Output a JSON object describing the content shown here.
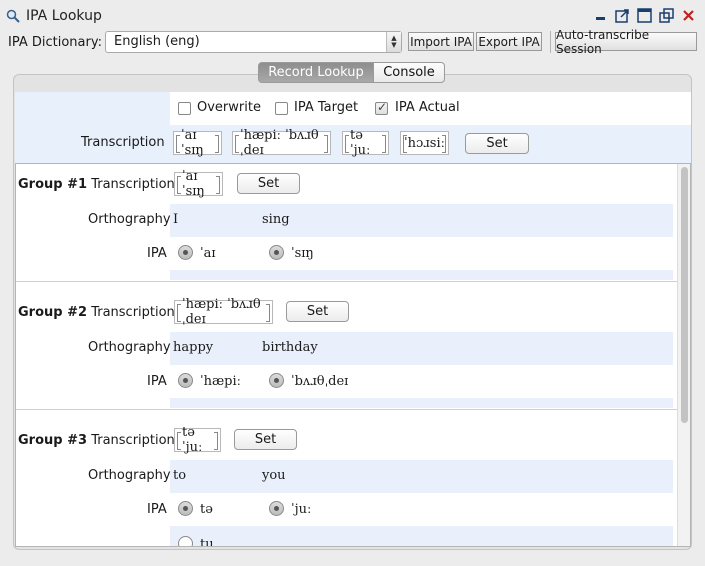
{
  "window": {
    "title": "IPA Lookup",
    "icon": "magnifier-icon"
  },
  "toolbar": {
    "dictionary_label": "IPA Dictionary:",
    "dictionary_value": "English (eng)",
    "import_label": "Import IPA",
    "export_label": "Export IPA",
    "auto_label": "Auto-transcribe Session"
  },
  "tabs": [
    {
      "label": "Record Lookup",
      "active": true
    },
    {
      "label": "Console",
      "active": false
    }
  ],
  "options": [
    {
      "label": "Overwrite",
      "checked": false
    },
    {
      "label": "IPA Target",
      "checked": false
    },
    {
      "label": "IPA Actual",
      "checked": true
    }
  ],
  "record": {
    "transcription_label": "Transcription",
    "words": [
      "ˈaɪ ˈsɪŋ",
      "ˈhæpiː ˈbʌɹθˌdeɪ",
      "tə ˈjuː",
      "ˈhɔɹsiː"
    ],
    "set_label": "Set"
  },
  "groups": [
    {
      "group_label": "Group #1",
      "transcription_label": "Transcription",
      "transcription": "ˈaɪ ˈsɪŋ",
      "set_label": "Set",
      "orthography_label": "Orthography",
      "orthography": [
        "I",
        "sing"
      ],
      "ipa_label": "IPA",
      "ipa": [
        "ˈaɪ",
        "ˈsɪŋ"
      ]
    },
    {
      "group_label": "Group #2",
      "transcription_label": "Transcription",
      "transcription": "ˈhæpiː ˈbʌɹθˌdeɪ",
      "set_label": "Set",
      "orthography_label": "Orthography",
      "orthography": [
        "happy",
        "birthday"
      ],
      "ipa_label": "IPA",
      "ipa": [
        "ˈhæpiː",
        "ˈbʌɹθˌdeɪ"
      ]
    },
    {
      "group_label": "Group #3",
      "transcription_label": "Transcription",
      "transcription": "tə ˈjuː",
      "set_label": "Set",
      "orthography_label": "Orthography",
      "orthography": [
        "to",
        "you"
      ],
      "ipa_label": "IPA",
      "ipa": [
        "tə",
        "ˈjuː"
      ],
      "extra_option": "tu"
    }
  ]
}
